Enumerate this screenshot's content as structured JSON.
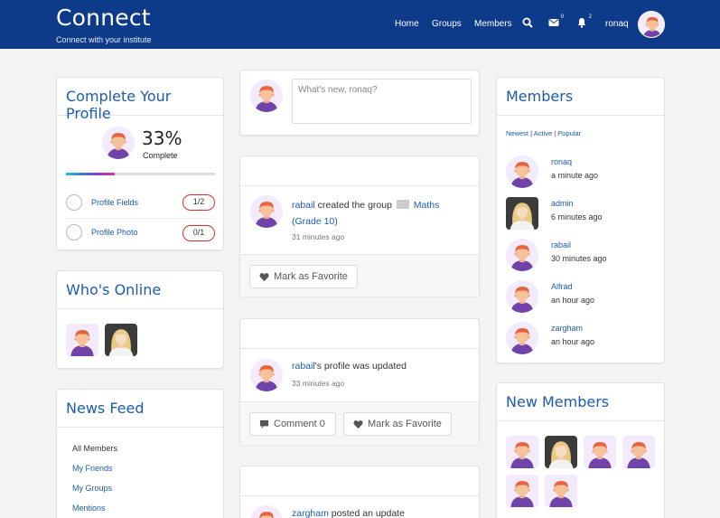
{
  "header": {
    "brand": "Connect",
    "tagline": "Connect with your institute",
    "nav": [
      "Home",
      "Groups",
      "Members"
    ],
    "messages_count": "0",
    "notifications_count": "2",
    "username": "ronaq",
    "bg_color": "#0d3b8a"
  },
  "profile": {
    "title": "Complete Your Profile",
    "percent": "33%",
    "percent_value": 33,
    "complete_label": "Complete",
    "items": [
      {
        "label": "Profile Fields",
        "progress": "1/2"
      },
      {
        "label": "Profile Photo",
        "progress": "0/1"
      }
    ]
  },
  "online": {
    "title": "Who's Online"
  },
  "newsfeed": {
    "title": "News Feed",
    "items": [
      "All Members",
      "My Friends",
      "My Groups",
      "Mentions"
    ]
  },
  "composer": {
    "placeholder": "What's new, ronaq?"
  },
  "feed": {
    "post1": {
      "user": "rabail",
      "text": "created the group",
      "group": "Maths",
      "group2": "(Grade 10)",
      "time": "31 minutes ago",
      "fav": "Mark as Favorite"
    },
    "post2": {
      "user": "rabail",
      "text": "'s profile was updated",
      "time": "33 minutes ago",
      "comment": "Comment 0",
      "fav": "Mark as Favorite"
    },
    "post3": {
      "user": "zargham",
      "text": "posted an update"
    }
  },
  "members": {
    "title": "Members",
    "filters": [
      "Newest",
      "Active",
      "Popular"
    ],
    "list": [
      {
        "name": "ronaq",
        "time": "a minute ago",
        "icon": "boy-avatar"
      },
      {
        "name": "admin",
        "time": "6 minutes ago",
        "icon": "girl-avatar"
      },
      {
        "name": "rabail",
        "time": "30 minutes ago",
        "icon": "boy-avatar"
      },
      {
        "name": "Alfrad",
        "time": "an hour ago",
        "icon": "boy-avatar"
      },
      {
        "name": "zargham",
        "time": "an hour ago",
        "icon": "boy-avatar"
      }
    ]
  },
  "new_members": {
    "title": "New Members"
  },
  "colors": {
    "accent": "#1c5cab",
    "badge_red": "#d03030"
  }
}
